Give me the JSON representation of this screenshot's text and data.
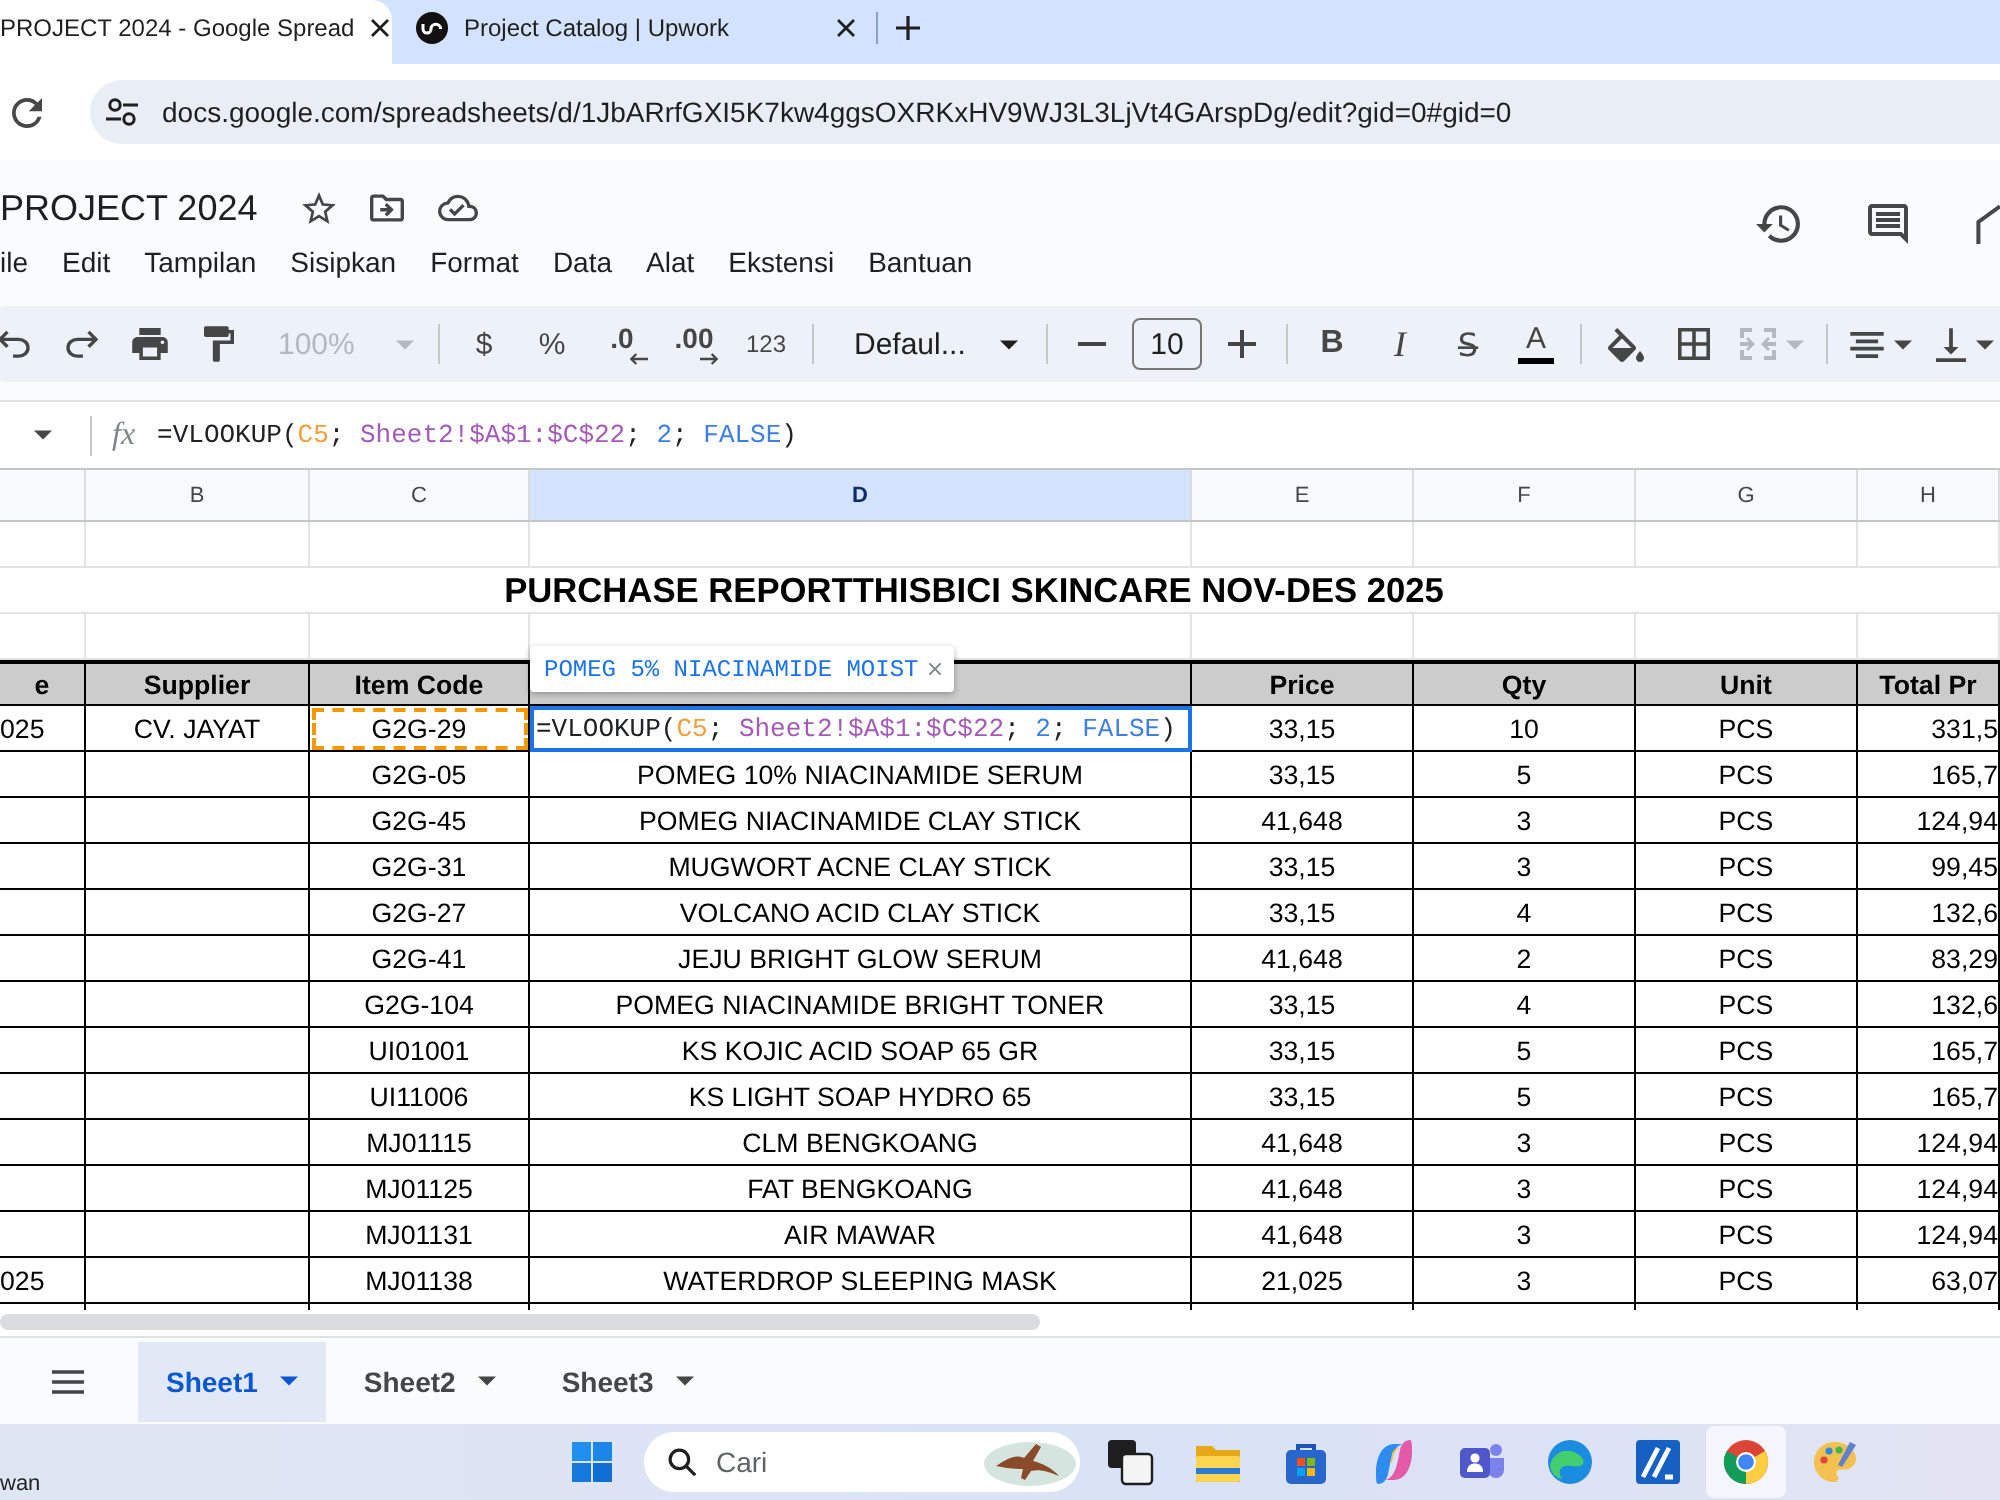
{
  "browser": {
    "tabs": [
      {
        "title": "PROJECT 2024 - Google Spread",
        "selected": true,
        "favicon": false
      },
      {
        "title": "Project Catalog | Upwork",
        "selected": false,
        "favicon": true
      }
    ],
    "address": "docs.google.com/spreadsheets/d/1JbARrfGXI5K7kw4ggsOXRKxHV9WJ3L3LjVt4GArspDg/edit?gid=0#gid=0"
  },
  "document": {
    "title": "PROJECT 2024",
    "menu": [
      "ile",
      "Edit",
      "Tampilan",
      "Sisipkan",
      "Format",
      "Data",
      "Alat",
      "Ekstensi",
      "Bantuan"
    ]
  },
  "toolbar": {
    "groups": [
      [
        {
          "kind": "undo",
          "disabled": false
        },
        {
          "kind": "redo",
          "disabled": false
        },
        {
          "kind": "print",
          "disabled": false
        },
        {
          "kind": "paint_format",
          "disabled": false
        },
        {
          "kind": "zoom",
          "label": "100%",
          "disabled": true
        }
      ],
      [
        {
          "kind": "currency",
          "label": "$",
          "disabled": false
        },
        {
          "kind": "percent",
          "label": "%",
          "disabled": false
        },
        {
          "kind": "decrease_decimal",
          "label": ".0",
          "disabled": false
        },
        {
          "kind": "increase_decimal",
          "label": ".00",
          "disabled": false
        },
        {
          "kind": "number_format",
          "label": "123",
          "disabled": false
        }
      ],
      [
        {
          "kind": "font",
          "label": "Defaul...",
          "disabled": false
        }
      ],
      [
        {
          "kind": "decrease_size",
          "disabled": false
        },
        {
          "kind": "font_size",
          "label": "10",
          "disabled": false
        },
        {
          "kind": "increase_size",
          "disabled": false
        }
      ],
      [
        {
          "kind": "bold",
          "label": "B",
          "disabled": false
        },
        {
          "kind": "italic",
          "label": "I",
          "disabled": false
        },
        {
          "kind": "strikethrough",
          "label": "S̶",
          "disabled": false
        },
        {
          "kind": "text_color",
          "label": "A",
          "disabled": false
        }
      ],
      [
        {
          "kind": "fill_color",
          "disabled": false
        },
        {
          "kind": "borders",
          "disabled": false
        },
        {
          "kind": "merge",
          "disabled": true
        }
      ],
      [
        {
          "kind": "align",
          "disabled": false
        },
        {
          "kind": "valign",
          "disabled": false
        }
      ]
    ]
  },
  "formula_bar": {
    "label": "fx",
    "tokens": [
      {
        "text": "=VLOOKUP(",
        "kind": "text"
      },
      {
        "text": "C5",
        "kind": "ref"
      },
      {
        "text": "; ",
        "kind": "text"
      },
      {
        "text": "Sheet2!$A$1:$C$22",
        "kind": "range"
      },
      {
        "text": "; ",
        "kind": "text"
      },
      {
        "text": "2",
        "kind": "literal"
      },
      {
        "text": "; ",
        "kind": "text"
      },
      {
        "text": "FALSE",
        "kind": "literal"
      },
      {
        "text": ")",
        "kind": "text"
      }
    ]
  },
  "columns": [
    {
      "selected": false
    },
    {
      "label": "B",
      "selected": false
    },
    {
      "label": "C",
      "selected": false
    },
    {
      "label": "D",
      "selected": true
    },
    {
      "label": "E",
      "selected": false
    },
    {
      "label": "F",
      "selected": false
    },
    {
      "label": "G",
      "selected": false
    },
    {
      "label": "H",
      "selected": false
    }
  ],
  "sheet": {
    "title": "PURCHASE REPORTTHISBICI SKINCARE NOV-DES 2025",
    "header": {
      "column_1": "e",
      "supplier": "Supplier",
      "item_code": "Item Code",
      "price": "Price",
      "qty": "Qty",
      "unit": "Unit",
      "total": "Total Pr"
    },
    "hint": "POMEG 5% NIACINAMIDE MOIST",
    "editor_tokens": [
      {
        "text": "=VLOOKUP(",
        "kind": "text"
      },
      {
        "text": "C5",
        "kind": "ref"
      },
      {
        "text": "; ",
        "kind": "text"
      },
      {
        "text": "Sheet2!$A$1:$C$22",
        "kind": "range"
      },
      {
        "text": "; ",
        "kind": "text"
      },
      {
        "text": "2",
        "kind": "literal"
      },
      {
        "text": "; ",
        "kind": "text"
      },
      {
        "text": "FALSE",
        "kind": "literal"
      },
      {
        "text": ")",
        "kind": "text"
      }
    ],
    "rows": [
      {
        "column_1": "025",
        "supplier": "CV. JAYAT",
        "item_code": "G2G-29",
        "price": "33,15",
        "qty": "10",
        "unit": "PCS",
        "total": "331,5",
        "editing": true,
        "ref": true
      },
      {
        "item_code": "G2G-05",
        "item_name": "POMEG 10% NIACINAMIDE SERUM",
        "price": "33,15",
        "qty": "5",
        "unit": "PCS",
        "total": "165,7",
        "editing": false,
        "ref": false
      },
      {
        "item_code": "G2G-45",
        "item_name": "POMEG NIACINAMIDE CLAY STICK",
        "price": "41,648",
        "qty": "3",
        "unit": "PCS",
        "total": "124,94",
        "editing": false,
        "ref": false
      },
      {
        "item_code": "G2G-31",
        "item_name": "MUGWORT ACNE CLAY STICK",
        "price": "33,15",
        "qty": "3",
        "unit": "PCS",
        "total": "99,45",
        "editing": false,
        "ref": false
      },
      {
        "item_code": "G2G-27",
        "item_name": "VOLCANO ACID CLAY STICK",
        "price": "33,15",
        "qty": "4",
        "unit": "PCS",
        "total": "132,6",
        "editing": false,
        "ref": false
      },
      {
        "item_code": "G2G-41",
        "item_name": "JEJU BRIGHT GLOW SERUM",
        "price": "41,648",
        "qty": "2",
        "unit": "PCS",
        "total": "83,29",
        "editing": false,
        "ref": false
      },
      {
        "item_code": "G2G-104",
        "item_name": "POMEG NIACINAMIDE BRIGHT TONER",
        "price": "33,15",
        "qty": "4",
        "unit": "PCS",
        "total": "132,6",
        "editing": false,
        "ref": false
      },
      {
        "item_code": "UI01001",
        "item_name": "KS KOJIC ACID SOAP 65 GR",
        "price": "33,15",
        "qty": "5",
        "unit": "PCS",
        "total": "165,7",
        "editing": false,
        "ref": false
      },
      {
        "item_code": "UI11006",
        "item_name": "KS LIGHT SOAP HYDRO 65",
        "price": "33,15",
        "qty": "5",
        "unit": "PCS",
        "total": "165,7",
        "editing": false,
        "ref": false
      },
      {
        "item_code": "MJ01115",
        "item_name": "CLM BENGKOANG",
        "price": "41,648",
        "qty": "3",
        "unit": "PCS",
        "total": "124,94",
        "editing": false,
        "ref": false
      },
      {
        "item_code": "MJ01125",
        "item_name": "FAT BENGKOANG",
        "price": "41,648",
        "qty": "3",
        "unit": "PCS",
        "total": "124,94",
        "editing": false,
        "ref": false
      },
      {
        "item_code": "MJ01131",
        "item_name": "AIR MAWAR",
        "price": "41,648",
        "qty": "3",
        "unit": "PCS",
        "total": "124,94",
        "editing": false,
        "ref": false
      },
      {
        "column_1": "025",
        "item_code": "MJ01138",
        "item_name": "WATERDROP SLEEPING MASK",
        "price": "21,025",
        "qty": "3",
        "unit": "PCS",
        "total": "63,07",
        "editing": false,
        "ref": false
      }
    ]
  },
  "sheet_tabs": [
    {
      "label": "Sheet1",
      "selected": true
    },
    {
      "label": "Sheet2",
      "selected": false
    },
    {
      "label": "Sheet3",
      "selected": false
    }
  ],
  "taskbar": {
    "weather": "wan",
    "search": {
      "placeholder": "Cari"
    },
    "apps": [
      {
        "kind": "task_view",
        "active": false
      },
      {
        "kind": "file_explorer",
        "active": false
      },
      {
        "kind": "store",
        "active": false
      },
      {
        "kind": "copilot",
        "active": false
      },
      {
        "kind": "teams",
        "active": false
      },
      {
        "kind": "edge",
        "active": false
      },
      {
        "kind": "stripes_tile",
        "active": false
      },
      {
        "kind": "chrome",
        "active": true
      },
      {
        "kind": "paint",
        "active": false
      }
    ]
  }
}
